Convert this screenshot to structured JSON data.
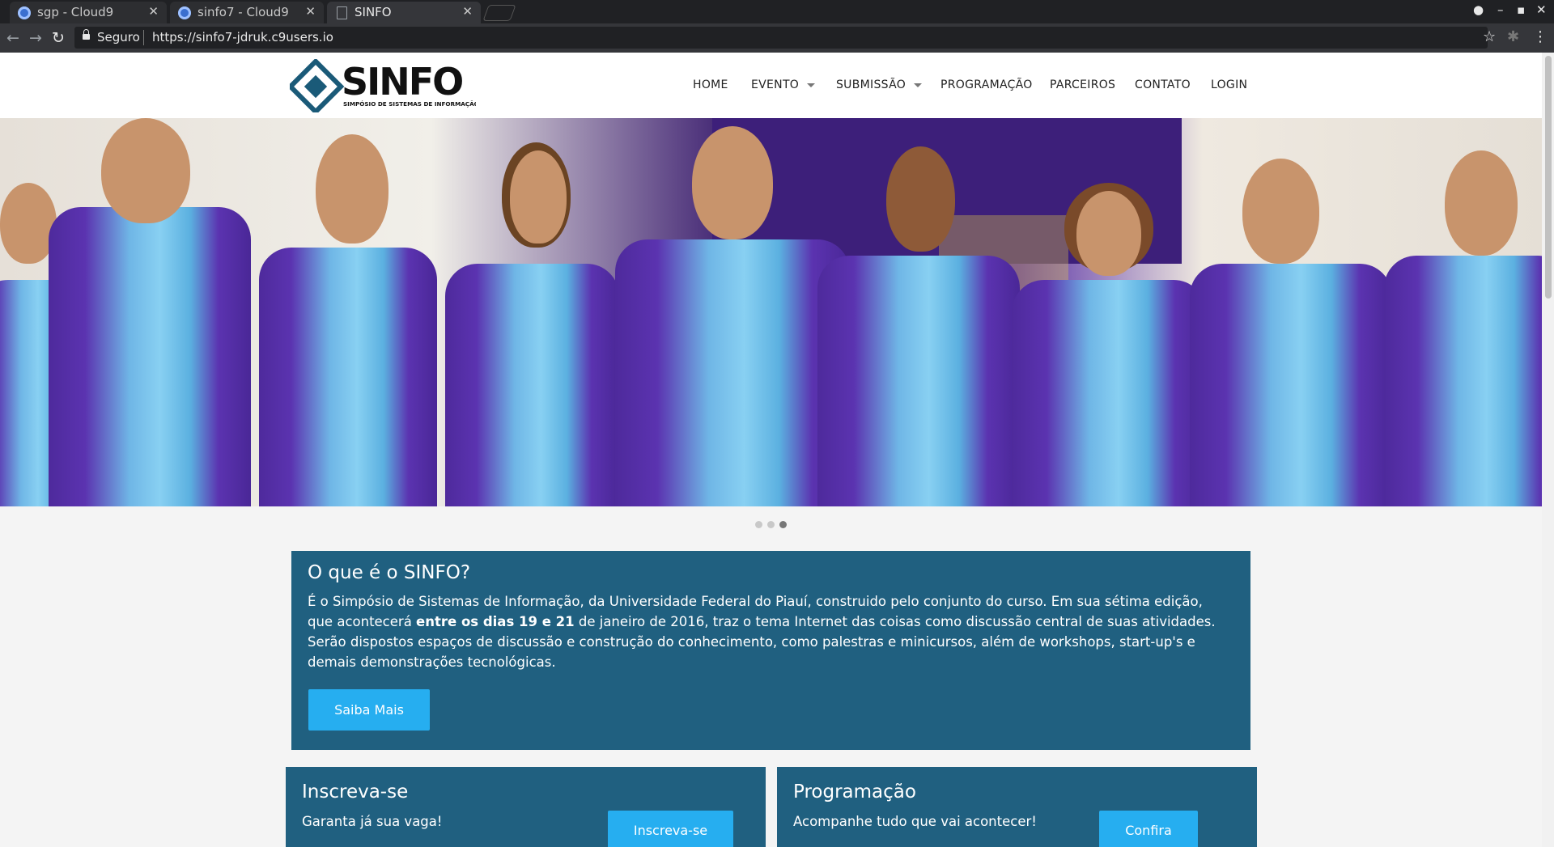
{
  "browser": {
    "tabs": [
      {
        "title": "sgp - Cloud9",
        "icon": "cloud9-icon",
        "active": false
      },
      {
        "title": "sinfo7 - Cloud9",
        "icon": "cloud9-icon",
        "active": false
      },
      {
        "title": "SINFO",
        "icon": "document-icon",
        "active": true
      }
    ],
    "security_label": "Seguro",
    "url": "https://sinfo7-jdruk.c9users.io"
  },
  "site": {
    "logo": {
      "name": "SINFO",
      "tagline": "SIMPÓSIO DE SISTEMAS DE INFORMAÇÃO"
    },
    "nav": [
      "HOME",
      "EVENTO",
      "SUBMISSÃO",
      "PROGRAMAÇÃO",
      "PARCEIROS",
      "CONTATO",
      "LOGIN"
    ],
    "carousel": {
      "slides": 3,
      "active_index": 2
    },
    "about": {
      "title": "O que é o SINFO?",
      "text_before": "É o Simpósio de Sistemas de Informação, da Universidade Federal do Piauí, construido pelo conjunto do curso. Em sua sétima edição, que acontecerá ",
      "text_bold": "entre os dias 19 e 21",
      "text_after": " de janeiro de 2016, traz o tema Internet das coisas como discussão central de suas atividades. Serão dispostos espaços de discussão e construção do conhecimento, como palestras e minicursos, além de workshops, start-up's e demais demonstrações tecnológicas.",
      "button": "Saiba Mais"
    },
    "cards": [
      {
        "title": "Inscreva-se",
        "subtitle": "Garanta já sua vaga!",
        "button": "Inscreva-se"
      },
      {
        "title": "Programação",
        "subtitle": "Acompanhe tudo que vai acontecer!",
        "button": "Confira"
      }
    ]
  },
  "colors": {
    "panel": "#206080",
    "button": "#26aef0",
    "shirt": "#5b33b0"
  }
}
